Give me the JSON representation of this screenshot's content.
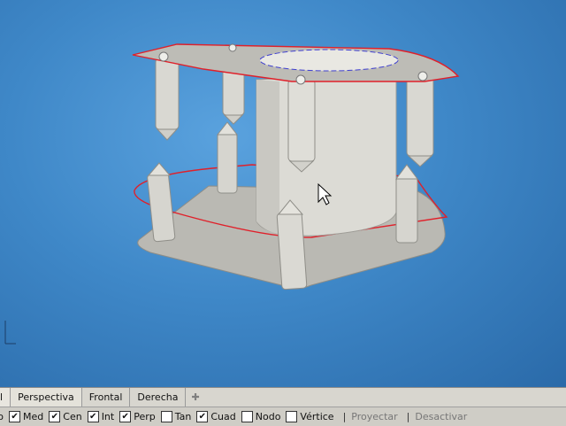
{
  "viewport": {
    "name": "Perspectiva",
    "scene": "3d-model-perspective"
  },
  "tabs": [
    {
      "label": "ntal",
      "active": false
    },
    {
      "label": "Perspectiva",
      "active": true
    },
    {
      "label": "Frontal",
      "active": false
    },
    {
      "label": "Derecha",
      "active": false
    }
  ],
  "add_tab_icon": "plus-icon",
  "snaps": [
    {
      "label": "nto",
      "checked": null
    },
    {
      "label": "Med",
      "checked": true
    },
    {
      "label": "Cen",
      "checked": true
    },
    {
      "label": "Int",
      "checked": true
    },
    {
      "label": "Perp",
      "checked": true
    },
    {
      "label": "Tan",
      "checked": false
    },
    {
      "label": "Cuad",
      "checked": true
    },
    {
      "label": "Nodo",
      "checked": false
    },
    {
      "label": "Vértice",
      "checked": false
    }
  ],
  "status_items": [
    "Proyectar",
    "Desactivar"
  ],
  "colors": {
    "viewport_bg": "#3f88c8",
    "selection_red": "#e0202a",
    "model_gray": "#c4c3bd",
    "tab_bar": "#d8d6cf"
  }
}
